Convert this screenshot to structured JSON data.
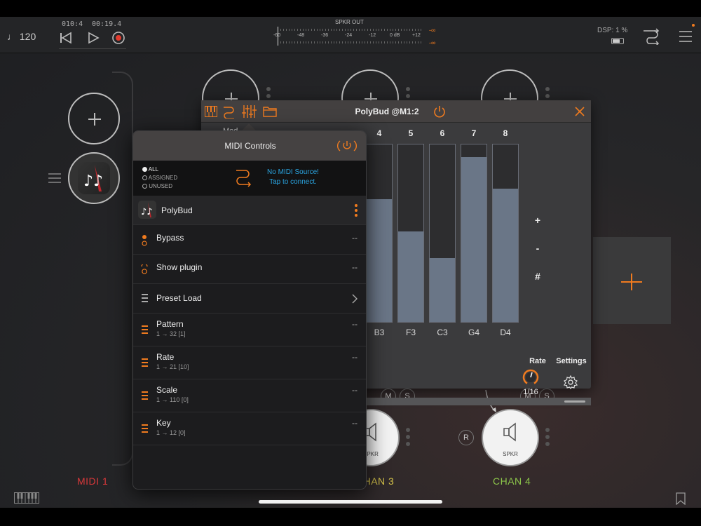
{
  "topbar": {
    "tempo": "♩ 120",
    "counter_bars": "010:4",
    "counter_time": "00:19.4",
    "meter_title": "SPKR OUT",
    "meter_scale": [
      "-60",
      "-48",
      "-36",
      "-24",
      "-12",
      "0 dB",
      "+12"
    ],
    "meter_inf_top": "-∞",
    "meter_inf_bottom": "-∞",
    "dsp": "DSP:  1 %"
  },
  "channels": {
    "midi1": "MIDI 1",
    "chan3": "CHAN 3",
    "chan4": "CHAN 4",
    "spkr": "SPKR",
    "m": "M",
    "s": "S",
    "r": "R"
  },
  "plugin": {
    "title": "PolyBud @M1:2",
    "step_numbers": [
      "4",
      "5",
      "6",
      "7",
      "8"
    ],
    "step_notes": [
      "B3",
      "F3",
      "C3",
      "G4",
      "D4"
    ],
    "step_levels": [
      0.69,
      0.51,
      0.36,
      0.93,
      0.75
    ],
    "side_buttons": [
      "+",
      "-",
      "#"
    ],
    "rate_label": "Rate",
    "rate_value": "1/16",
    "settings_label": "Settings",
    "partial_label": "Mod"
  },
  "midi": {
    "title": "MIDI Controls",
    "filters": [
      "ALL",
      "ASSIGNED",
      "UNUSED"
    ],
    "source_line1": "No MIDI Source!",
    "source_line2": "Tap to connect.",
    "plugin_name": "PolyBud",
    "rows": [
      {
        "label": "Bypass",
        "sub": "",
        "value": "--"
      },
      {
        "label": "Show plugin",
        "sub": "",
        "value": "--"
      },
      {
        "label": "Preset Load",
        "sub": "",
        "value": ""
      },
      {
        "label": "Pattern",
        "sub": "1 → 32 [1]",
        "value": "--"
      },
      {
        "label": "Rate",
        "sub": "1 → 21 [10]",
        "value": "--"
      },
      {
        "label": "Scale",
        "sub": "1 → 110 [0]",
        "value": "--"
      },
      {
        "label": "Key",
        "sub": "1 → 12 [0]",
        "value": "--"
      }
    ]
  },
  "colors": {
    "accent": "#f07b1f",
    "link": "#2aa4e0",
    "midi_red": "#d9383a",
    "chan_green": "#8bc34a",
    "chan3_yellow": "#d4c24a",
    "step_fill": "#6a7687"
  }
}
